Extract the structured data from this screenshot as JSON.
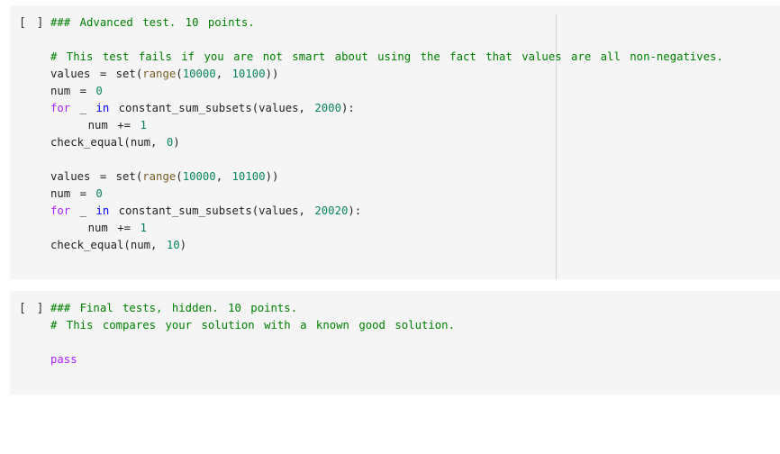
{
  "cells": [
    {
      "run_label": "[ ]",
      "lines": [
        [
          {
            "t": "cm",
            "v": "### Advanced test. 10 points."
          }
        ],
        [],
        [
          {
            "t": "cm",
            "v": "# This test fails if you are not smart about using the fact that values are all non-negatives."
          }
        ],
        [
          {
            "t": "",
            "v": "values = set("
          },
          {
            "t": "bi",
            "v": "range"
          },
          {
            "t": "",
            "v": "("
          },
          {
            "t": "nu",
            "v": "10000"
          },
          {
            "t": "",
            "v": ", "
          },
          {
            "t": "nu",
            "v": "10100"
          },
          {
            "t": "",
            "v": "))"
          }
        ],
        [
          {
            "t": "",
            "v": "num = "
          },
          {
            "t": "nu",
            "v": "0"
          }
        ],
        [
          {
            "t": "kw",
            "v": "for"
          },
          {
            "t": "",
            "v": " _ "
          },
          {
            "t": "kb",
            "v": "in"
          },
          {
            "t": "",
            "v": " constant_sum_subsets(values, "
          },
          {
            "t": "nu",
            "v": "2000"
          },
          {
            "t": "",
            "v": "):"
          }
        ],
        [
          {
            "t": "",
            "v": "    num += "
          },
          {
            "t": "nu",
            "v": "1"
          }
        ],
        [
          {
            "t": "",
            "v": "check_equal(num, "
          },
          {
            "t": "nu",
            "v": "0"
          },
          {
            "t": "",
            "v": ")"
          }
        ],
        [],
        [
          {
            "t": "",
            "v": "values = set("
          },
          {
            "t": "bi",
            "v": "range"
          },
          {
            "t": "",
            "v": "("
          },
          {
            "t": "nu",
            "v": "10000"
          },
          {
            "t": "",
            "v": ", "
          },
          {
            "t": "nu",
            "v": "10100"
          },
          {
            "t": "",
            "v": "))"
          }
        ],
        [
          {
            "t": "",
            "v": "num = "
          },
          {
            "t": "nu",
            "v": "0"
          }
        ],
        [
          {
            "t": "kw",
            "v": "for"
          },
          {
            "t": "",
            "v": " _ "
          },
          {
            "t": "kb",
            "v": "in"
          },
          {
            "t": "",
            "v": " constant_sum_subsets(values, "
          },
          {
            "t": "nu",
            "v": "20020"
          },
          {
            "t": "",
            "v": "):"
          }
        ],
        [
          {
            "t": "",
            "v": "    num += "
          },
          {
            "t": "nu",
            "v": "1"
          }
        ],
        [
          {
            "t": "",
            "v": "check_equal(num, "
          },
          {
            "t": "nu",
            "v": "10"
          },
          {
            "t": "",
            "v": ")"
          }
        ]
      ]
    },
    {
      "run_label": "[ ]",
      "lines": [
        [
          {
            "t": "cm",
            "v": "### Final tests, hidden. 10 points."
          }
        ],
        [
          {
            "t": "cm",
            "v": "# This compares your solution with a known good solution."
          }
        ],
        [],
        [
          {
            "t": "kw",
            "v": "pass"
          }
        ]
      ]
    }
  ]
}
